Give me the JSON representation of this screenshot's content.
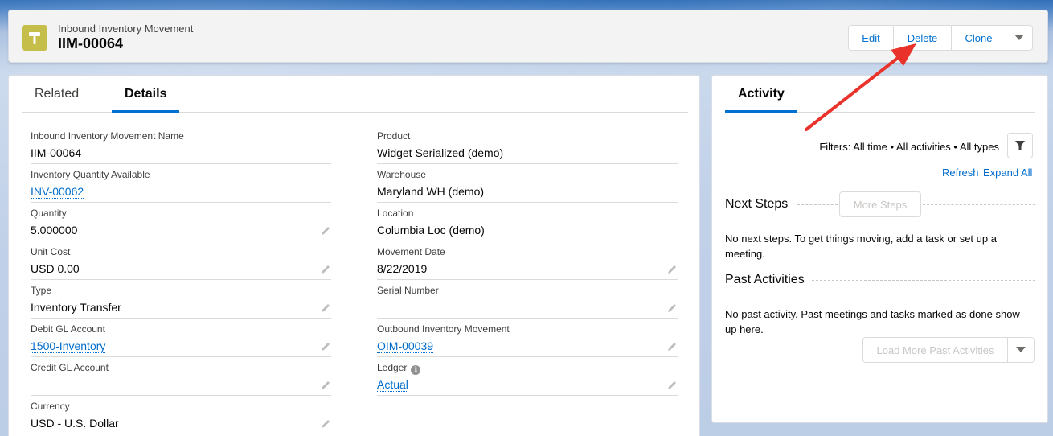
{
  "header": {
    "object_label": "Inbound Inventory Movement",
    "record_title": "IIM-00064",
    "icon": "hammer-icon",
    "icon_color": "#c5be4a",
    "buttons": {
      "edit": "Edit",
      "delete": "Delete",
      "clone": "Clone"
    }
  },
  "details": {
    "tabs": {
      "related": "Related",
      "details": "Details"
    },
    "left_fields": [
      {
        "label": "Inbound Inventory Movement Name",
        "value": "IIM-00064"
      },
      {
        "label": "Inventory Quantity Available",
        "value": "INV-00062"
      },
      {
        "label": "Quantity",
        "value": "5.000000"
      },
      {
        "label": "Unit Cost",
        "value": "USD 0.00"
      },
      {
        "label": "Type",
        "value": "Inventory Transfer"
      },
      {
        "label": "Debit GL Account",
        "value": "1500-Inventory"
      },
      {
        "label": "Credit GL Account",
        "value": ""
      },
      {
        "label": "Currency",
        "value": "USD - U.S. Dollar"
      }
    ],
    "right_fields": [
      {
        "label": "Product",
        "value": "Widget Serialized (demo)"
      },
      {
        "label": "Warehouse",
        "value": "Maryland WH (demo)"
      },
      {
        "label": "Location",
        "value": "Columbia Loc (demo)"
      },
      {
        "label": "Movement Date",
        "value": "8/22/2019"
      },
      {
        "label": "Serial Number",
        "value": ""
      },
      {
        "label": "Outbound Inventory Movement",
        "value": "OIM-00039"
      },
      {
        "label": "Ledger",
        "value": "Actual"
      }
    ]
  },
  "activity": {
    "tab": "Activity",
    "filters": "Filters: All time • All activities • All types",
    "refresh": "Refresh",
    "expand_all": "Expand All",
    "next_steps_title": "Next Steps",
    "more_steps": "More Steps",
    "next_steps_msg": "No next steps. To get things moving, add a task or set up a meeting.",
    "past_title": "Past Activities",
    "past_msg": "No past activity. Past meetings and tasks marked as done show up here.",
    "load_more": "Load More Past Activities"
  },
  "colors": {
    "link": "#006dcc",
    "brand": "#0070d2",
    "annotation_arrow": "#e8322a"
  }
}
